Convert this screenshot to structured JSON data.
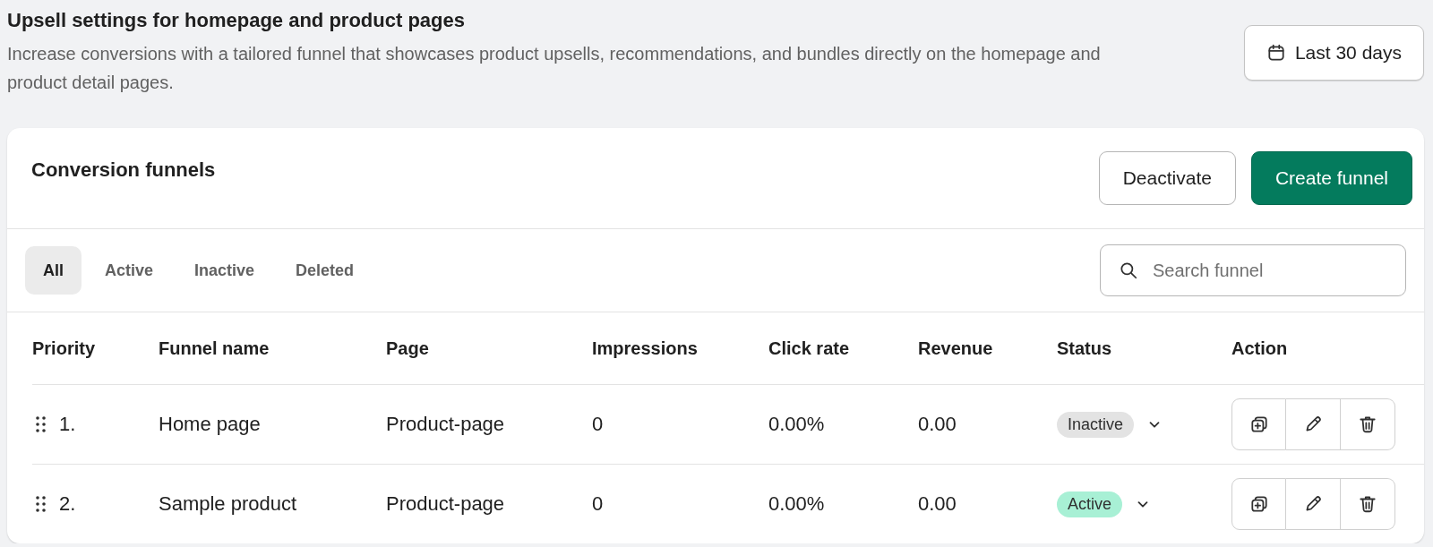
{
  "header": {
    "title": "Upsell settings for homepage and product pages",
    "description": "Increase conversions with a tailored funnel that showcases product upsells, recommendations, and bundles directly on the homepage and product detail pages.",
    "date_range": "Last 30 days"
  },
  "card": {
    "title": "Conversion funnels",
    "buttons": [
      {
        "label": "Deactivate",
        "kind": "secondary"
      },
      {
        "label": "Create funnel",
        "kind": "primary"
      }
    ]
  },
  "tabs": [
    {
      "label": "All",
      "selected": true
    },
    {
      "label": "Active",
      "selected": false
    },
    {
      "label": "Inactive",
      "selected": false
    },
    {
      "label": "Deleted",
      "selected": false
    }
  ],
  "search": {
    "placeholder": "Search funnel"
  },
  "table": {
    "columns": [
      "Priority",
      "Funnel name",
      "Page",
      "Impressions",
      "Click rate",
      "Revenue",
      "Status",
      "Action"
    ],
    "rows": [
      {
        "priority": "1.",
        "name": "Home page",
        "page": "Product-page",
        "impressions": "0",
        "click_rate": "0.00%",
        "revenue": "0.00",
        "status": {
          "label": "Inactive",
          "color": "#e3e3e3"
        }
      },
      {
        "priority": "2.",
        "name": "Sample product",
        "page": "Product-page",
        "impressions": "0",
        "click_rate": "0.00%",
        "revenue": "0.00",
        "status": {
          "label": "Active",
          "color": "#a8f0d5"
        }
      }
    ]
  }
}
